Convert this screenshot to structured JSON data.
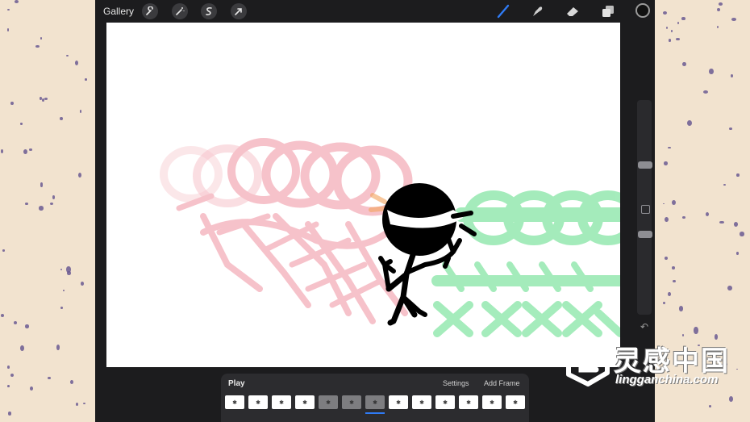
{
  "toolbar": {
    "gallery_label": "Gallery",
    "left_tools": [
      "wrench-icon",
      "magic-wand-icon",
      "selection-icon",
      "transform-arrow-icon"
    ],
    "right_tools": [
      "brush-icon",
      "smudge-icon",
      "eraser-icon",
      "layers-icon"
    ],
    "current_color": "#111111",
    "active_tool_color": "#2f7bf5"
  },
  "sidebar": {
    "undo_icon": "undo-icon",
    "modify_icon": "modify-square-icon"
  },
  "timeline": {
    "play_label": "Play",
    "settings_label": "Settings",
    "add_frame_label": "Add Frame",
    "frame_count": 13,
    "selected_frame": 7,
    "onion_skin_frames": [
      5,
      6,
      7
    ]
  },
  "canvas": {
    "onion_before_color": "#e8546a",
    "onion_after_color": "#38d46a",
    "stroke_color": "#000000"
  },
  "watermark": {
    "title": "灵感中国",
    "subtitle": "lingganchina.com"
  }
}
